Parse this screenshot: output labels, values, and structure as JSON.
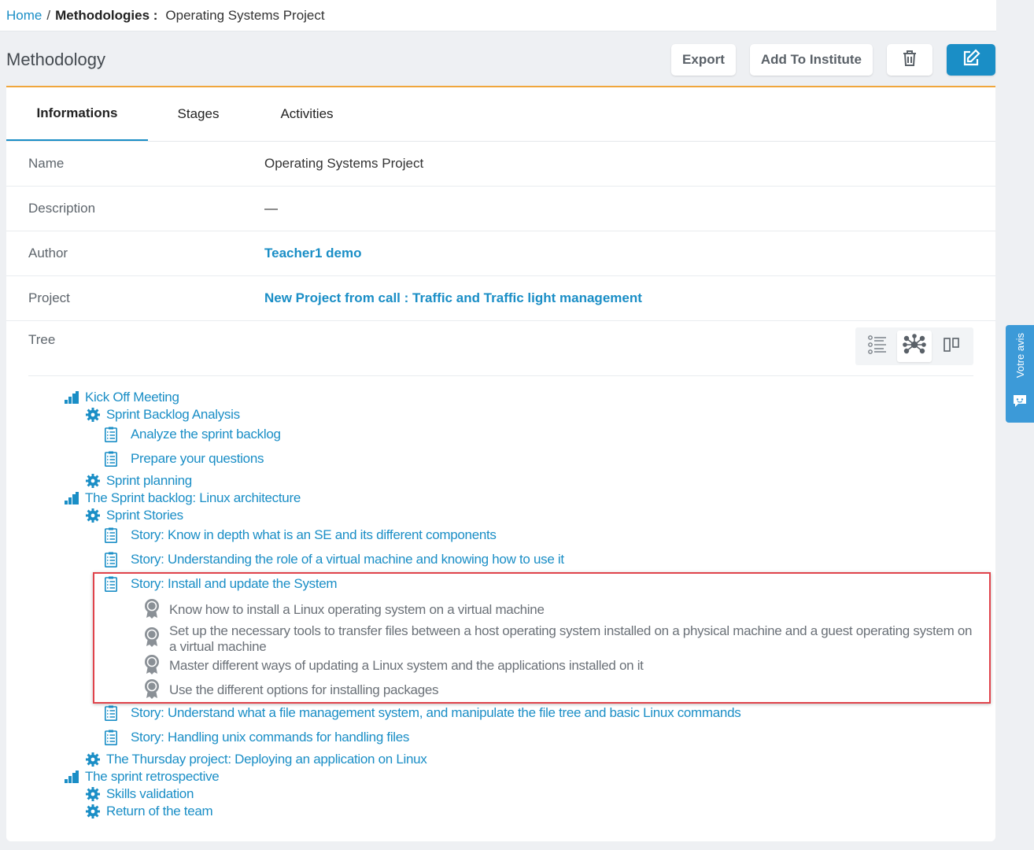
{
  "breadcrumb": {
    "home": "Home",
    "separator": "/",
    "section": "Methodologies :",
    "current": "Operating Systems Project"
  },
  "header": {
    "title": "Methodology",
    "export_label": "Export",
    "add_institute_label": "Add To Institute"
  },
  "icons": {
    "delete": "trash-icon",
    "edit": "edit-icon",
    "feedback": "chat-icon"
  },
  "tabs": [
    {
      "label": "Informations",
      "active": true
    },
    {
      "label": "Stages",
      "active": false
    },
    {
      "label": "Activities",
      "active": false
    }
  ],
  "info": {
    "name_label": "Name",
    "name_value": "Operating Systems Project",
    "description_label": "Description",
    "description_value": "—",
    "author_label": "Author",
    "author_value": "Teacher1 demo",
    "project_label": "Project",
    "project_value": "New Project from call : Traffic and Traffic light management",
    "tree_label": "Tree"
  },
  "tree": {
    "n1": "Kick Off Meeting",
    "n2": "Sprint Backlog Analysis",
    "n3": "Analyze the sprint backlog",
    "n4": "Prepare your questions",
    "n5": "Sprint planning",
    "n6": "The Sprint backlog: Linux architecture",
    "n7": "Sprint Stories",
    "n8": "Story: Know in depth what is an SE and its different components",
    "n9": "Story: Understanding the role of a virtual machine and knowing how to use it",
    "n10": "Story: Install and update the System",
    "n11": "Know how to install a Linux operating system on a virtual machine",
    "n12a": "Set up the necessary tools to transfer files between a host operating system installed on a physical machine and a guest operating system on",
    "n12b": "a virtual machine",
    "n13": "Master different ways of updating a Linux system and the applications installed on it",
    "n14": "Use the different options for installing packages",
    "n15": "Story: Understand what a file management system, and manipulate the file tree and basic Linux commands",
    "n16": "Story: Handling unix commands for handling files",
    "n17": "The Thursday project: Deploying an application on Linux",
    "n18": "The sprint retrospective",
    "n19": "Skills validation",
    "n20": "Return of the team"
  },
  "feedback": {
    "label": "Votre avis"
  },
  "colors": {
    "accent": "#1a8ec6",
    "tab_top_border": "#f0a63c",
    "highlight": "#e0434b",
    "feedback_bg": "#3c9ad8"
  }
}
